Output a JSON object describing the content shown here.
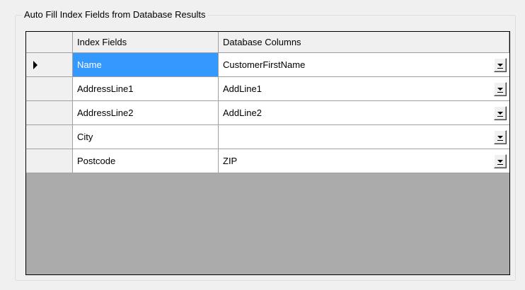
{
  "group": {
    "caption": "Auto Fill Index Fields from Database Results"
  },
  "grid": {
    "columns": [
      "Index Fields",
      "Database Columns"
    ],
    "selected_row": 0,
    "rows": [
      {
        "index_field": "Name",
        "database_column": "CustomerFirstName"
      },
      {
        "index_field": "AddressLine1",
        "database_column": "AddLine1"
      },
      {
        "index_field": "AddressLine2",
        "database_column": "AddLine2"
      },
      {
        "index_field": "City",
        "database_column": ""
      },
      {
        "index_field": "Postcode",
        "database_column": "ZIP"
      }
    ]
  },
  "icons": {
    "row_indicator": "current-row-arrow-icon",
    "dropdown": "dropdown-arrow-icon"
  },
  "colors": {
    "selection": "#3399ff",
    "grid_background": "#ababab",
    "window": "#f0f0f0"
  }
}
